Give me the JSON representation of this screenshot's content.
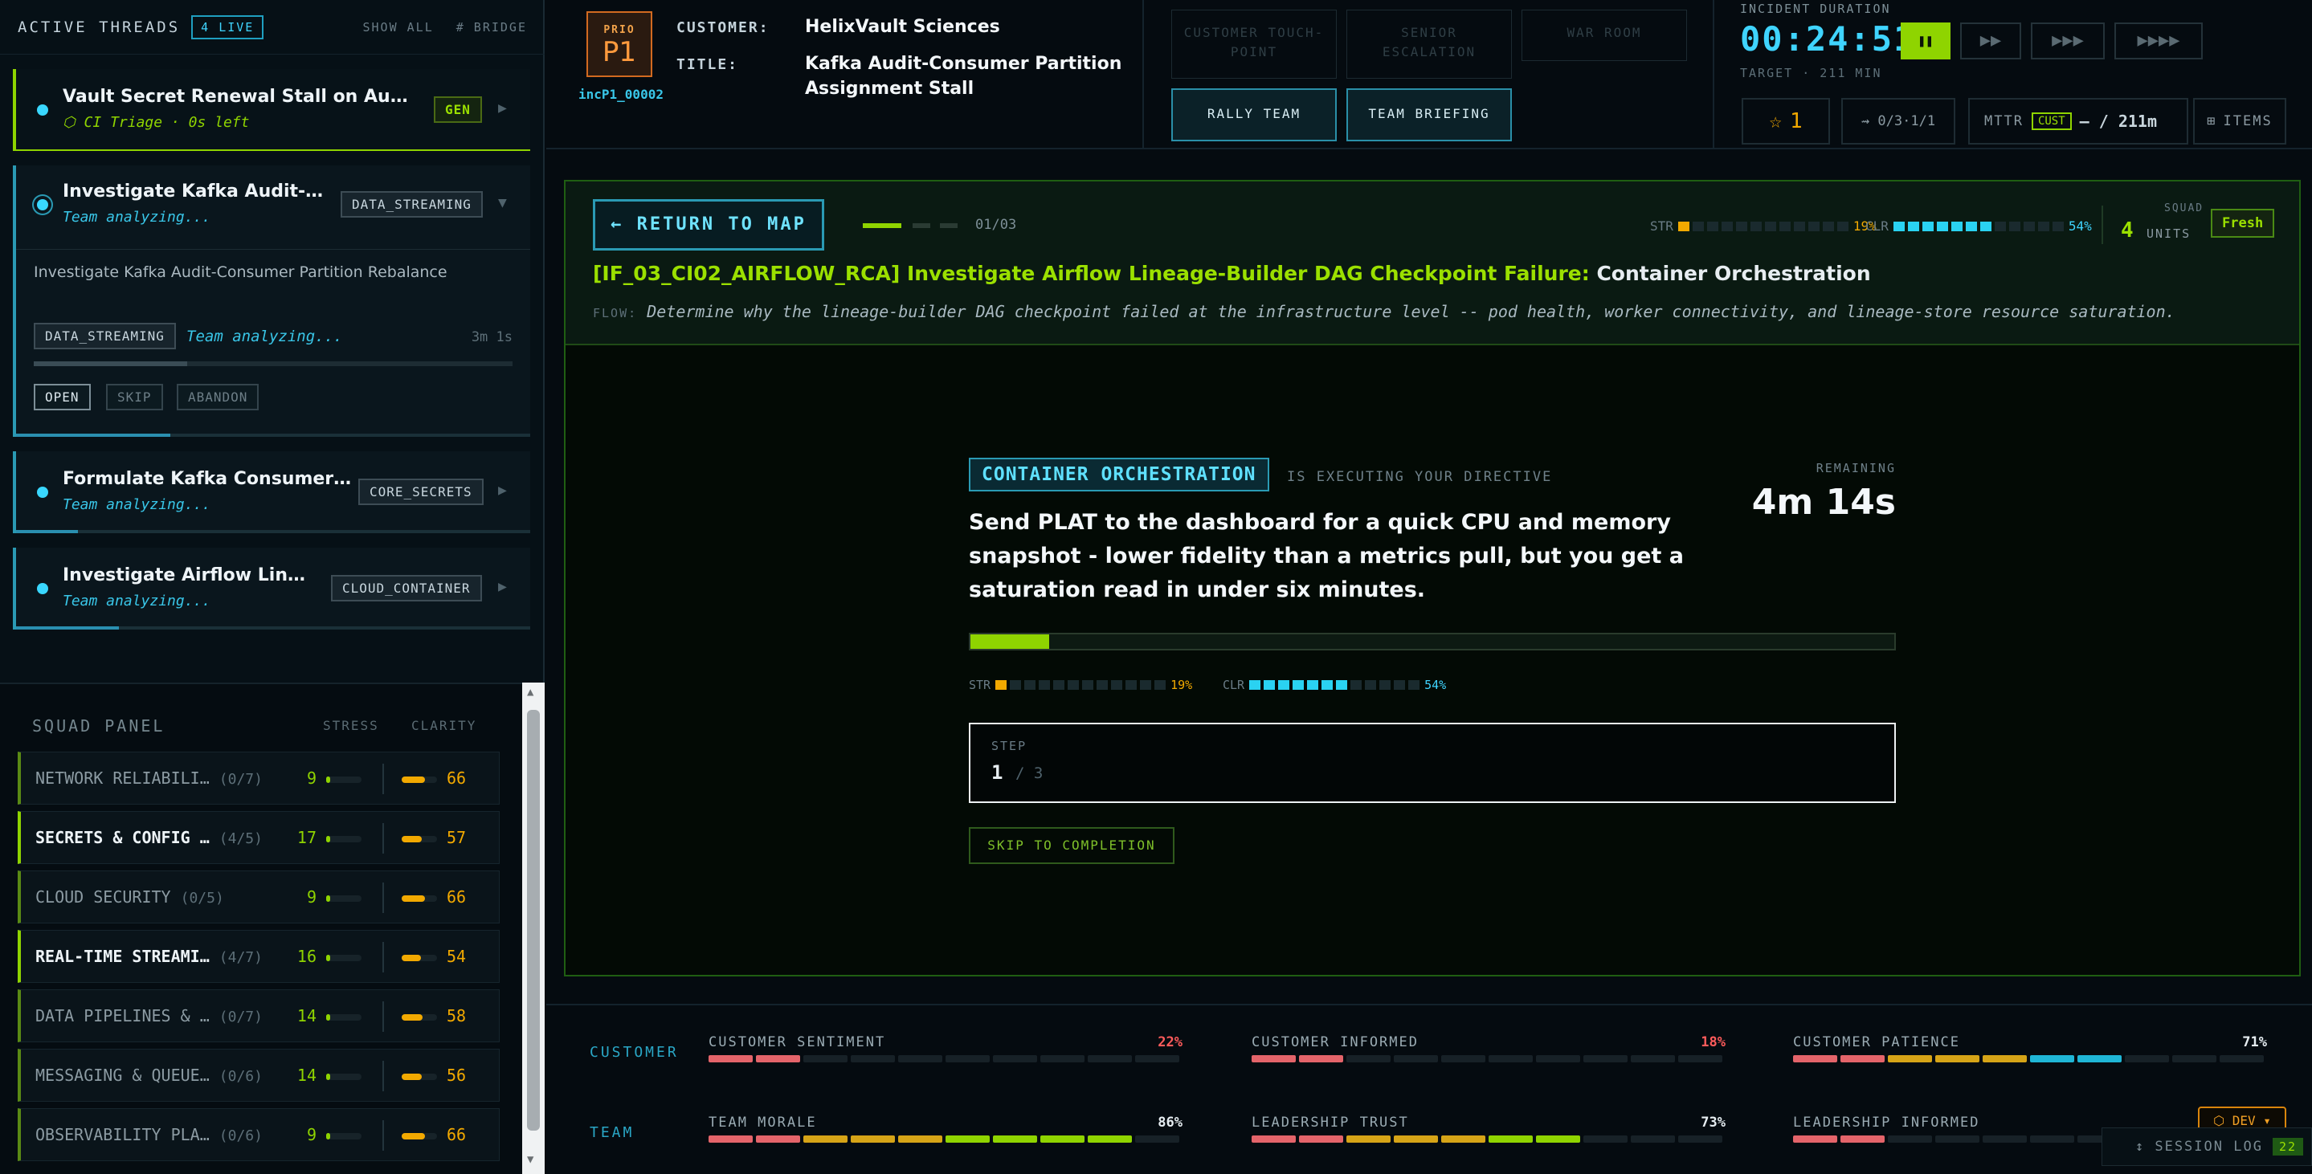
{
  "threads_header": {
    "title": "ACTIVE THREADS",
    "live": "4 LIVE",
    "show_all": "SHOW ALL",
    "bridge": "# BRIDGE"
  },
  "threads": [
    {
      "name": "Vault Secret Renewal Stall on Au…",
      "sub": "⬡ CI Triage · 0s left",
      "tag": "GEN",
      "progress": 1.0
    },
    {
      "name": "Investigate Kafka Audit-…",
      "sub": "Team analyzing...",
      "tag": "DATA_STREAMING",
      "desc": "Investigate Kafka Audit-Consumer Partition Rebalance",
      "detail_tag": "DATA_STREAMING",
      "detail_status": "Team analyzing...",
      "elapsed": "3m 1s",
      "progress": 0.3,
      "actions": [
        "OPEN",
        "SKIP",
        "ABANDON"
      ]
    },
    {
      "name": "Formulate Kafka Consumer …",
      "sub": "Team analyzing...",
      "tag": "CORE_SECRETS",
      "progress": 0.12
    },
    {
      "name": "Investigate Airflow Lin…",
      "sub": "Team analyzing...",
      "tag": "CLOUD_CONTAINER",
      "progress": 0.2
    }
  ],
  "squad_panel": {
    "title": "SQUAD PANEL",
    "stress_label": "STRESS",
    "clarity_label": "CLARITY",
    "rows": [
      {
        "name": "NETWORK RELIABILI…",
        "count": "(0/7)",
        "stress": 9,
        "clarity": 66,
        "active": false
      },
      {
        "name": "SECRETS & CONFIG …",
        "count": "(4/5)",
        "stress": 17,
        "clarity": 57,
        "active": true
      },
      {
        "name": "CLOUD SECURITY",
        "count": "(0/5)",
        "stress": 9,
        "clarity": 66,
        "active": false
      },
      {
        "name": "REAL-TIME STREAMI…",
        "count": "(4/7)",
        "stress": 16,
        "clarity": 54,
        "active": true
      },
      {
        "name": "DATA PIPELINES & …",
        "count": "(0/7)",
        "stress": 14,
        "clarity": 58,
        "active": false
      },
      {
        "name": "MESSAGING & QUEUE…",
        "count": "(0/6)",
        "stress": 14,
        "clarity": 56,
        "active": false
      },
      {
        "name": "OBSERVABILITY PLA…",
        "count": "(0/6)",
        "stress": 9,
        "clarity": 66,
        "active": false
      }
    ]
  },
  "incident": {
    "prio_label": "PRIO",
    "prio": "P1",
    "id": "incP1_00002",
    "customer_label": "CUSTOMER:",
    "customer": "HelixVault Sciences",
    "title_label": "TITLE:",
    "title_line1": "Kafka Audit-Consumer Partition",
    "title_line2": "Assignment Stall"
  },
  "top_buttons": {
    "touchpoint_1": "CUSTOMER TOUCH-",
    "touchpoint_2": "POINT",
    "escalation_1": "SENIOR",
    "escalation_2": "ESCALATION",
    "war_room": "WAR ROOM",
    "rally": "RALLY TEAM",
    "briefing": "TEAM BRIEFING"
  },
  "timer": {
    "label": "INCIDENT DURATION",
    "value": "00:24:51",
    "target": "TARGET · 211 MIN",
    "pause": "❚❚",
    "speed2": "▶▶",
    "speed3": "▶▶▶",
    "speed4": "▶▶▶▶"
  },
  "stats": {
    "stars": "1",
    "flow": "⇝ 0/3·1/1",
    "mttr_label": "MTTR",
    "cust": "CUST",
    "mttr_value": "— / 211m",
    "items": "ITEMS"
  },
  "task": {
    "return": "← RETURN TO MAP",
    "step_count": "01/03",
    "step_progress": 0.33,
    "str_label": "STR",
    "str_pct": "19%",
    "str_value": 0.19,
    "clr_label": "CLR",
    "clr_pct": "54%",
    "clr_value": 0.54,
    "squad_label": "SQUAD",
    "squad_units": "4",
    "units_label": "UNITS",
    "fresh": "Fresh",
    "title_code": "[IF_03_CI02_AIRFLOW_RCA] Investigate Airflow Lineage-Builder DAG Checkpoint Failure:",
    "title_team": "Container Orchestration",
    "flow_label": "FLOW:",
    "flow": "Determine why the lineage-builder DAG checkpoint failed at the infrastructure level -- pod health, worker connectivity, and lineage-store resource saturation."
  },
  "directive": {
    "team": "CONTAINER ORCHESTRATION",
    "executing": "IS EXECUTING YOUR DIRECTIVE",
    "remaining_label": "REMAINING",
    "remaining": "4m 14s",
    "text": "Send PLAT to the dashboard for a quick CPU and memory snapshot - lower fidelity than a metrics pull, but you get a saturation read in under six minutes.",
    "progress": 0.085,
    "str_label": "STR",
    "str_pct": "19%",
    "clr_label": "CLR",
    "clr_pct": "54%",
    "step_label": "STEP",
    "step": "1",
    "step_total": "/ 3",
    "skip": "SKIP TO COMPLETION"
  },
  "meters": {
    "customer_label": "CUSTOMER",
    "team_label": "TEAM",
    "customer": [
      {
        "name": "CUSTOMER SENTIMENT",
        "pct": "22%",
        "value": 0.22,
        "color": "#ff5b5b"
      },
      {
        "name": "CUSTOMER INFORMED",
        "pct": "18%",
        "value": 0.18,
        "color": "#ff5b5b"
      },
      {
        "name": "CUSTOMER PATIENCE",
        "pct": "71%",
        "value": 0.71,
        "color": "#e6edf1"
      }
    ],
    "team": [
      {
        "name": "TEAM MORALE",
        "pct": "86%",
        "value": 0.86,
        "color": "#e6edf1"
      },
      {
        "name": "LEADERSHIP TRUST",
        "pct": "73%",
        "value": 0.73,
        "color": "#e6edf1"
      },
      {
        "name": "LEADERSHIP INFORMED",
        "pct": "",
        "value": 0.2,
        "color": "#e6edf1"
      }
    ]
  },
  "footer": {
    "dev": "⬡ DEV ▾",
    "session_log": "↕ SESSION LOG",
    "log_count": "22"
  },
  "colors": {
    "accent": "#8fd400",
    "cyan": "#39d7ff",
    "warn": "#f2a900",
    "danger": "#e4646a"
  }
}
